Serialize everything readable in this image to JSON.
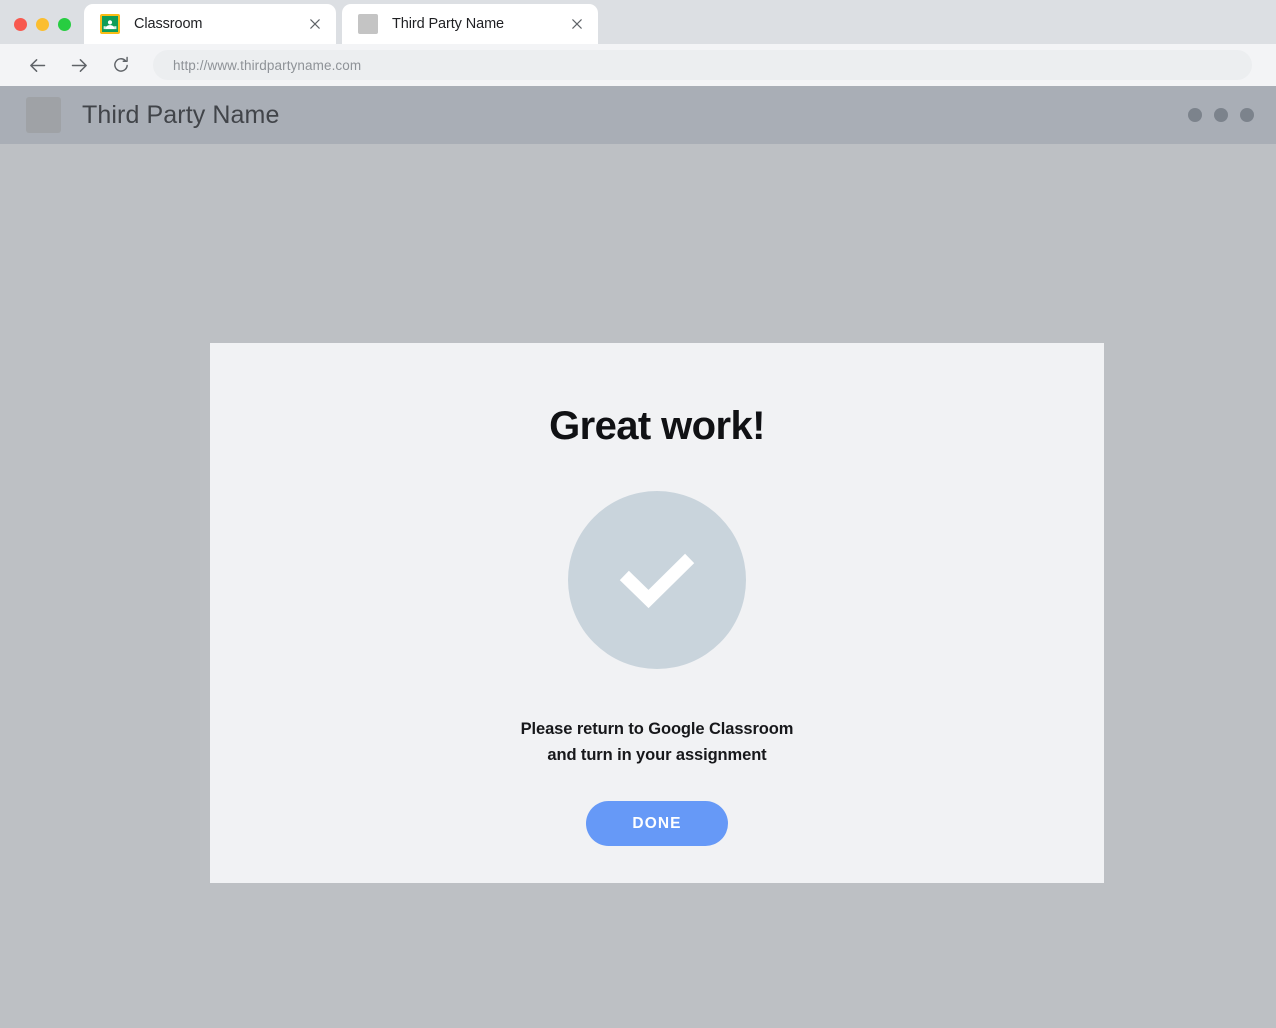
{
  "browser": {
    "window_controls": [
      {
        "name": "close",
        "color": "#f8594f"
      },
      {
        "name": "minimize",
        "color": "#fbbe2f"
      },
      {
        "name": "maximize",
        "color": "#27cd41"
      }
    ],
    "tabs": [
      {
        "title": "Classroom",
        "favicon": "google-classroom-icon",
        "active": false,
        "close_label": "×"
      },
      {
        "title": "Third Party Name",
        "favicon": "placeholder-favicon",
        "active": true,
        "close_label": "×"
      }
    ],
    "toolbar": {
      "back_icon": "arrow-left-icon",
      "forward_icon": "arrow-right-icon",
      "reload_icon": "reload-icon",
      "address_value": "http://www.thirdpartyname.com"
    }
  },
  "site": {
    "header": {
      "logo": "placeholder-logo",
      "title": "Third Party Name",
      "menu_icon": "three-dots-icon",
      "menu_dot_count": 3
    },
    "card": {
      "heading": "Great work!",
      "status_icon": "checkmark-circle-icon",
      "message_line_1": "Please return to Google Classroom",
      "message_line_2": "and turn in your assignment",
      "primary_button": "DONE"
    }
  },
  "colors": {
    "page_background": "#bdc0c4",
    "site_header": "#a9aeb6",
    "card_background": "#f1f2f4",
    "accent_blue": "#6699f7",
    "check_circle": "#c9d4dc",
    "chrome_tabstrip": "#dcdfe3",
    "chrome_toolbar": "#f3f4f6"
  }
}
